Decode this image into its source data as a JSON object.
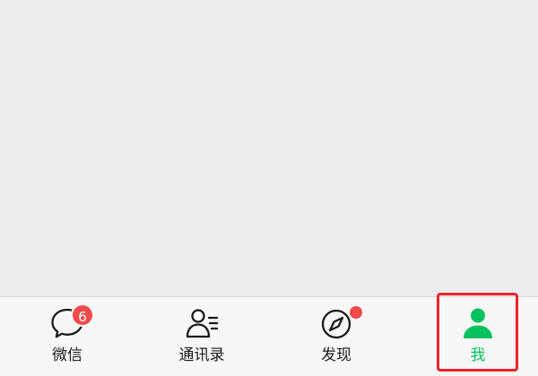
{
  "tabbar": {
    "tabs": [
      {
        "label": "微信",
        "icon": "chat-bubble-icon",
        "badge": "6",
        "active": false
      },
      {
        "label": "通讯录",
        "icon": "contacts-icon",
        "active": false
      },
      {
        "label": "发现",
        "icon": "compass-icon",
        "dot": true,
        "active": false
      },
      {
        "label": "我",
        "icon": "person-icon",
        "active": true
      }
    ]
  },
  "colors": {
    "active": "#07c160",
    "badge": "#f04a4a",
    "highlight": "#e8262c",
    "tabbar_bg": "#f7f7f7",
    "content_bg": "#ededed"
  }
}
